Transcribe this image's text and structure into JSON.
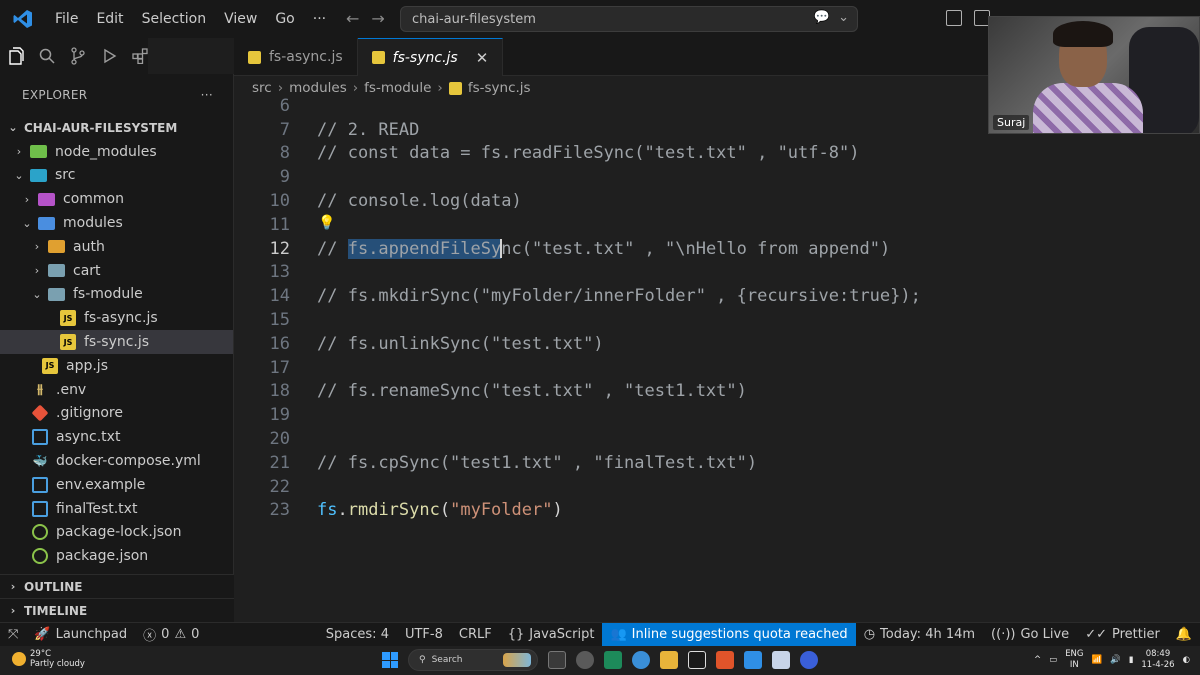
{
  "window": {
    "menu": [
      "File",
      "Edit",
      "Selection",
      "View",
      "Go",
      "···"
    ],
    "command_center": "chai-aur-filesystem"
  },
  "sidebar": {
    "title": "EXPLORER",
    "more": "···",
    "root": "CHAI-AUR-FILESYSTEM",
    "items": [
      {
        "label": "node_modules"
      },
      {
        "label": "src"
      },
      {
        "label": "common"
      },
      {
        "label": "modules"
      },
      {
        "label": "auth"
      },
      {
        "label": "cart"
      },
      {
        "label": "fs-module"
      },
      {
        "label": "fs-async.js"
      },
      {
        "label": "fs-sync.js"
      },
      {
        "label": "app.js"
      },
      {
        "label": ".env"
      },
      {
        "label": ".gitignore"
      },
      {
        "label": "async.txt"
      },
      {
        "label": "docker-compose.yml"
      },
      {
        "label": "env.example"
      },
      {
        "label": "finalTest.txt"
      },
      {
        "label": "package-lock.json"
      },
      {
        "label": "package.json"
      }
    ],
    "outline": "OUTLINE",
    "timeline": "TIMELINE"
  },
  "tabs": [
    {
      "label": "fs-async.js"
    },
    {
      "label": "fs-sync.js"
    }
  ],
  "breadcrumb": [
    "src",
    "modules",
    "fs-module",
    "fs-sync.js"
  ],
  "editor": {
    "lines": [
      {
        "n": "6",
        "parts": []
      },
      {
        "n": "7",
        "parts": [
          {
            "cls": "c-comment",
            "t": "// 2. READ"
          }
        ]
      },
      {
        "n": "8",
        "parts": [
          {
            "cls": "c-comment",
            "t": "// const data = fs.readFileSync(\"test.txt\" , \"utf-8\")"
          }
        ]
      },
      {
        "n": "9",
        "parts": []
      },
      {
        "n": "10",
        "parts": [
          {
            "cls": "c-comment",
            "t": "// console.log(data)"
          }
        ]
      },
      {
        "n": "11",
        "parts": []
      },
      {
        "n": "12",
        "parts": [
          {
            "cls": "c-comment",
            "t": "// "
          },
          {
            "cls": "c-comment sel",
            "t": "fs.appendFileSy"
          },
          {
            "cls": "c-comment",
            "t": "nc(\"test.txt\" , \"\\nHello from append\")"
          }
        ]
      },
      {
        "n": "13",
        "parts": []
      },
      {
        "n": "14",
        "parts": [
          {
            "cls": "c-comment",
            "t": "// fs.mkdirSync(\"myFolder/innerFolder\" , {recursive:true});"
          }
        ]
      },
      {
        "n": "15",
        "parts": []
      },
      {
        "n": "16",
        "parts": [
          {
            "cls": "c-comment",
            "t": "// fs.unlinkSync(\"test.txt\")"
          }
        ]
      },
      {
        "n": "17",
        "parts": []
      },
      {
        "n": "18",
        "parts": [
          {
            "cls": "c-comment",
            "t": "// fs.renameSync(\"test.txt\" , \"test1.txt\")"
          }
        ]
      },
      {
        "n": "19",
        "parts": []
      },
      {
        "n": "20",
        "parts": []
      },
      {
        "n": "21",
        "parts": [
          {
            "cls": "c-comment",
            "t": "// fs.cpSync(\"test1.txt\" , \"finalTest.txt\")"
          }
        ]
      },
      {
        "n": "22",
        "parts": []
      },
      {
        "n": "23",
        "parts": [
          {
            "cls": "c-obj",
            "t": "fs"
          },
          {
            "cls": "c-plain",
            "t": "."
          },
          {
            "cls": "c-fn",
            "t": "rmdirSync"
          },
          {
            "cls": "c-plain",
            "t": "("
          },
          {
            "cls": "c-str",
            "t": "\"myFolder\""
          },
          {
            "cls": "c-plain",
            "t": ")"
          }
        ]
      }
    ],
    "current_line": "12"
  },
  "webcam": {
    "name": "Suraj"
  },
  "statusbar": {
    "launchpad": "Launchpad",
    "errors": "0",
    "warnings": "0",
    "spaces": "Spaces: 4",
    "encoding": "UTF-8",
    "eol": "CRLF",
    "language": "JavaScript",
    "quota": "Inline suggestions quota reached",
    "time": "Today: 4h 14m",
    "golive": "Go Live",
    "prettier": "Prettier"
  },
  "taskbar": {
    "temp": "29°C",
    "weather": "Partly cloudy",
    "search": "Search",
    "lang1": "ENG",
    "lang2": "IN",
    "time": "08:49",
    "date": "11-4-26"
  },
  "colors": {
    "accent": "#0078d4",
    "selection": "#264f78",
    "comment": "#9ea3a8",
    "string": "#ce9178",
    "function": "#dcdcaa"
  }
}
